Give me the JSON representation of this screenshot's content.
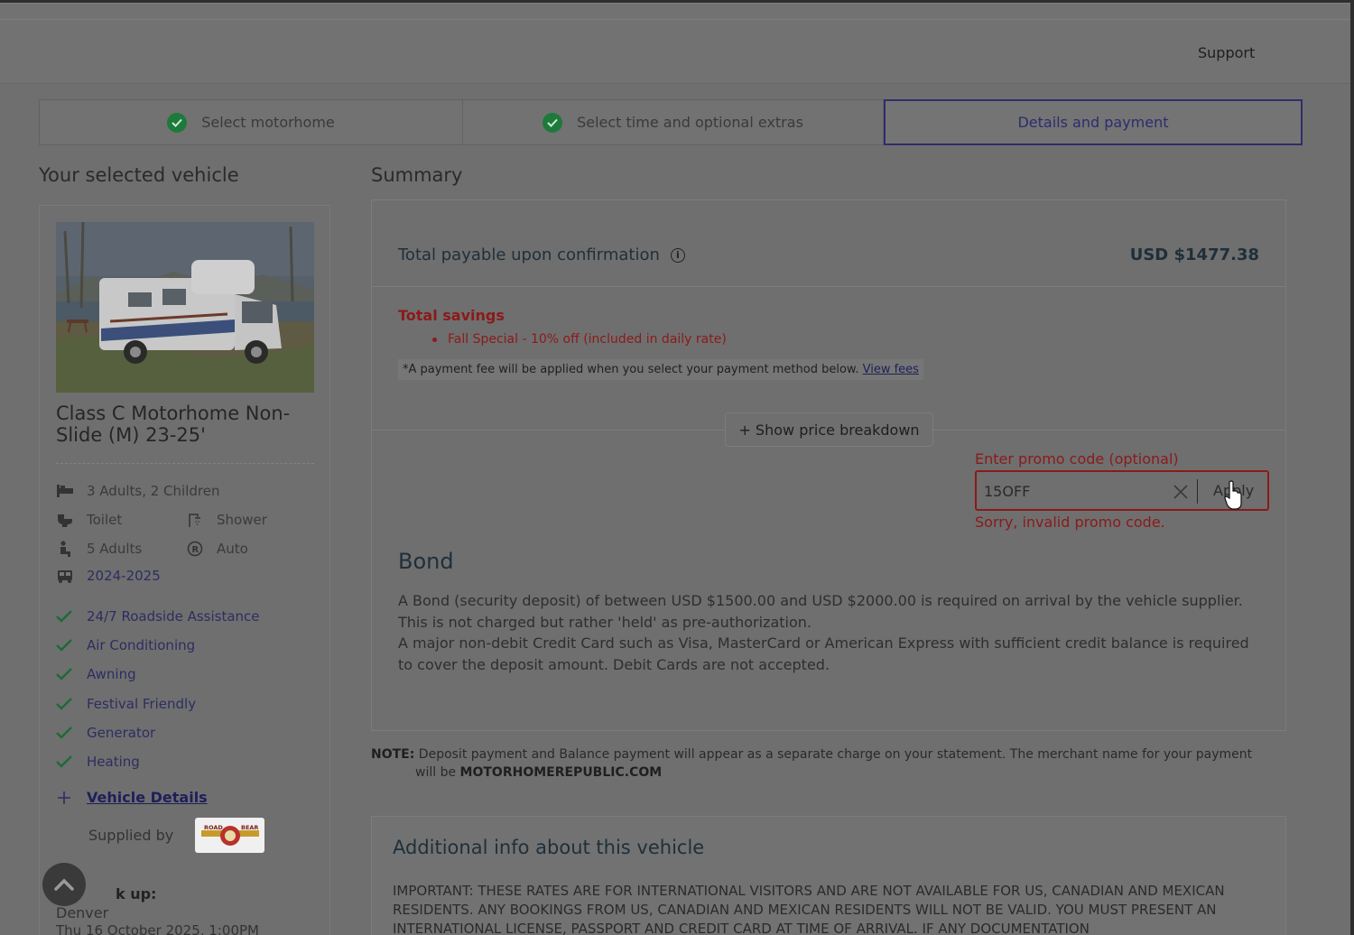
{
  "header": {
    "support_label": "Support"
  },
  "steps": [
    {
      "label": "Select motorhome",
      "done": true
    },
    {
      "label": "Select time and optional extras",
      "done": true
    },
    {
      "label": "Details and payment",
      "active": true
    }
  ],
  "left": {
    "heading": "Your selected vehicle",
    "vehicle_name": "Class C Motorhome Non-Slide (M) 23-25'",
    "features": {
      "sleeps": "3 Adults, 2 Children",
      "toilet": "Toilet",
      "shower": "Shower",
      "seats": "5 Adults",
      "transmission": "Auto",
      "year": "2024-2025"
    },
    "amenities": [
      "24/7 Roadside Assistance",
      "Air Conditioning",
      "Awning",
      "Festival Friendly",
      "Generator",
      "Heating"
    ],
    "vehicle_details_label": "Vehicle Details",
    "supplied_by_label": "Supplied by",
    "supplier_logo_text": "ROAD BEAR",
    "pickup_label": "k up:",
    "pickup_city": "Denver",
    "pickup_date": "Thu 16 October 2025, 1:00PM"
  },
  "summary": {
    "heading": "Summary",
    "total_label": "Total payable upon confirmation",
    "total_value": "USD $1477.38",
    "savings_title": "Total savings",
    "savings_item": "Fall Special - 10% off (included in daily rate)",
    "fee_note": "*A payment fee will be applied when you select your payment method below.",
    "fee_link": "View fees",
    "breakdown_button": "+ Show price breakdown",
    "promo": {
      "label": "Enter promo code (optional)",
      "value": "15OFF",
      "apply_label": "Apply",
      "error": "Sorry, invalid promo code."
    },
    "bond_title": "Bond",
    "bond_lines": [
      "A Bond (security deposit) of between USD $1500.00 and USD $2000.00 is required on arrival by the vehicle supplier.",
      "This is not charged but rather 'held' as pre-authorization.",
      "A major non-debit Credit Card such as Visa, MasterCard or American Express with sufficient credit balance is required to cover the deposit amount. Debit Cards are not accepted."
    ]
  },
  "note": {
    "label": "NOTE:",
    "text": "Deposit payment and Balance payment will appear as a separate charge on your statement. The merchant name for your payment",
    "text2": "will be",
    "merchant": "MOTORHOMEREPUBLIC.COM"
  },
  "additional": {
    "title": "Additional info about this vehicle",
    "text": "IMPORTANT: THESE RATES ARE FOR INTERNATIONAL VISITORS AND ARE NOT AVAILABLE FOR US, CANADIAN AND MEXICAN RESIDENTS. ANY BOOKINGS FROM US, CANADIAN AND MEXICAN RESIDENTS WILL NOT BE VALID. YOU MUST PRESENT AN INTERNATIONAL LICENSE, PASSPORT AND CREDIT CARD AT TIME OF ARRIVAL. IF ANY DOCUMENTATION"
  },
  "colors": {
    "accent": "#2c2c70",
    "success": "#1d7a3a",
    "error": "#8b1a1a",
    "overlay_bg": "#6f6f6f"
  }
}
